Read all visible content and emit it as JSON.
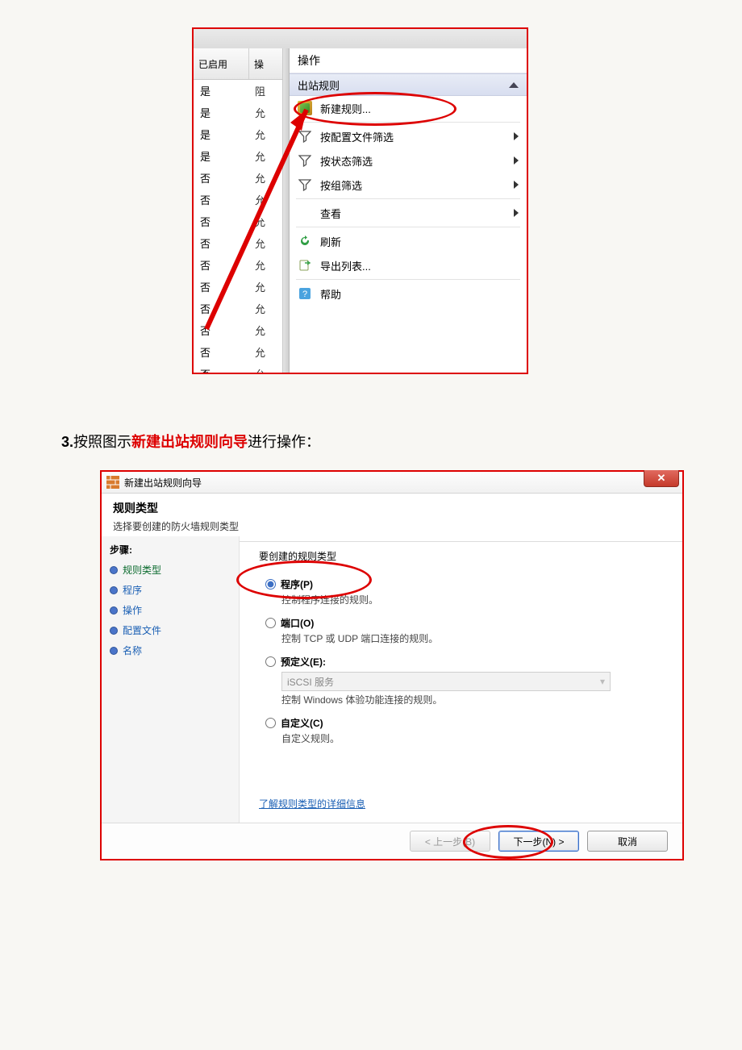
{
  "shot1": {
    "left": {
      "header_col1": "已启用",
      "header_col2": "操",
      "rows": [
        {
          "c1": "是",
          "c2": "阻"
        },
        {
          "c1": "是",
          "c2": "允"
        },
        {
          "c1": "是",
          "c2": "允"
        },
        {
          "c1": "是",
          "c2": "允"
        },
        {
          "c1": "否",
          "c2": "允"
        },
        {
          "c1": "否",
          "c2": "允"
        },
        {
          "c1": "否",
          "c2": "允"
        },
        {
          "c1": "否",
          "c2": "允"
        },
        {
          "c1": "否",
          "c2": "允"
        },
        {
          "c1": "否",
          "c2": "允"
        },
        {
          "c1": "否",
          "c2": "允"
        },
        {
          "c1": "否",
          "c2": "允"
        },
        {
          "c1": "否",
          "c2": "允"
        },
        {
          "c1": "否",
          "c2": "允"
        }
      ]
    },
    "actions": {
      "title": "操作",
      "sub": "出站规则",
      "items": {
        "new_rule": "新建规则...",
        "filter_profile": "按配置文件筛选",
        "filter_state": "按状态筛选",
        "filter_group": "按组筛选",
        "view": "查看",
        "refresh": "刷新",
        "export": "导出列表...",
        "help": "帮助"
      }
    }
  },
  "caption": {
    "num": "3.",
    "part1": "按照图示",
    "red": "新建出站规则向导",
    "part2": "进行操作："
  },
  "wizard": {
    "window_title": "新建出站规则向导",
    "header_title": "规则类型",
    "header_sub": "选择要创建的防火墙规则类型",
    "steps_header": "步骤:",
    "steps": {
      "rule_type": "规则类型",
      "program": "程序",
      "action": "操作",
      "profile": "配置文件",
      "name": "名称"
    },
    "main": {
      "question": "要创建的规则类型",
      "opt_program_t": "程序(P)",
      "opt_program_d": "控制程序连接的规则。",
      "opt_port_t": "端口(O)",
      "opt_port_d": "控制 TCP 或 UDP 端口连接的规则。",
      "opt_predef_t": "预定义(E):",
      "opt_predef_sel": "iSCSI 服务",
      "opt_predef_d": "控制 Windows 体验功能连接的规则。",
      "opt_custom_t": "自定义(C)",
      "opt_custom_d": "自定义规则。",
      "learn_link": "了解规则类型的详细信息"
    },
    "buttons": {
      "back": "< 上一步(B)",
      "next": "下一步(N) >",
      "cancel": "取消"
    }
  }
}
